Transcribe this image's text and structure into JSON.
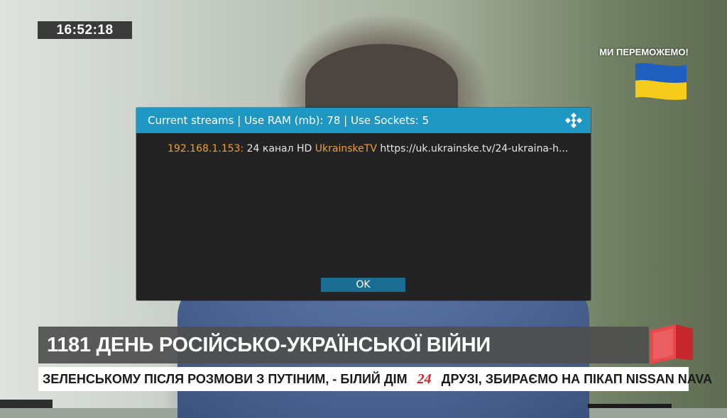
{
  "overlay": {
    "clock": "16:52:18",
    "slogan": "МИ ПЕРЕМОЖЕМО!",
    "flag_colors": [
      "#1f5fbf",
      "#f5cc1a"
    ]
  },
  "dialog": {
    "title": "Current streams | Use RAM (mb): 78 | Use Sockets: 5",
    "logo_icon": "kodi-logo-icon",
    "accent_color": "#1f97c3",
    "streams": [
      {
        "ip": "192.168.1.153:",
        "name": "24 канал HD",
        "source": "UkrainskeTV",
        "url": "https://uk.ukrainske.tv/24-ukraina-h..."
      }
    ],
    "ok_label": "OK"
  },
  "lower_third": {
    "headline": "1181 ДЕНЬ РОСІЙСЬКО-УКРАЇНСЬКОЇ ВІЙНИ",
    "ticker_left": "ЗЕЛЕНСЬКОМУ ПІСЛЯ РОЗМОВИ З ПУТІНИМ, - БІЛИЙ ДІМ",
    "ticker_badge": "24",
    "ticker_right": "ДРУЗІ, ЗБИРАЄМО НА ПІКАП NISSAN NAVA",
    "brand_color": "#d8242a"
  }
}
